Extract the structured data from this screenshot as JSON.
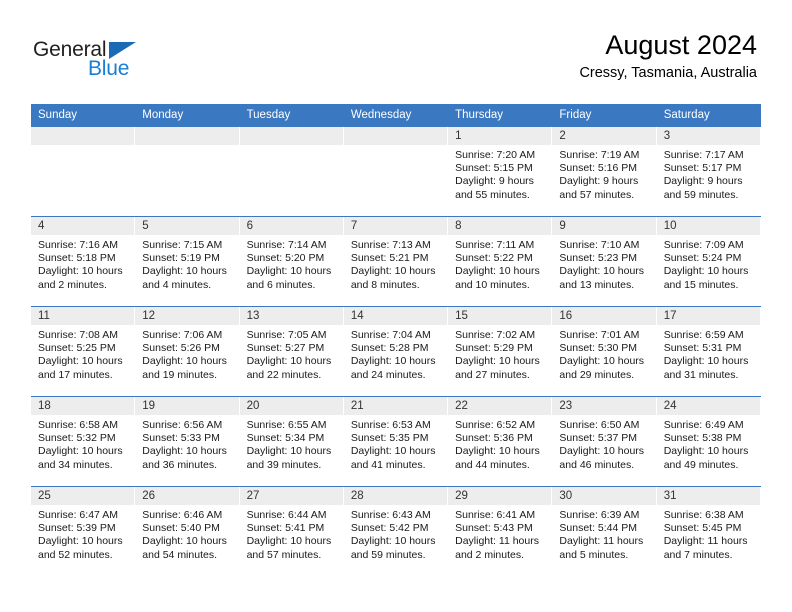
{
  "brand": {
    "name_part1": "General",
    "name_part2": "Blue",
    "triangle_color": "#1a6bb5",
    "blue_color": "#1a7fd4"
  },
  "header": {
    "title": "August 2024",
    "subtitle": "Cressy, Tasmania, Australia"
  },
  "theme": {
    "header_bg": "#3a78c2",
    "header_text": "#ffffff",
    "daynum_bg": "#ededed",
    "cell_bg": "#ffffff",
    "grid_line": "#3a78c2"
  },
  "weekday_headers": [
    "Sunday",
    "Monday",
    "Tuesday",
    "Wednesday",
    "Thursday",
    "Friday",
    "Saturday"
  ],
  "weeks": [
    [
      {
        "day": "",
        "sunrise": "",
        "sunset": "",
        "daylight_line1": "",
        "daylight_line2": ""
      },
      {
        "day": "",
        "sunrise": "",
        "sunset": "",
        "daylight_line1": "",
        "daylight_line2": ""
      },
      {
        "day": "",
        "sunrise": "",
        "sunset": "",
        "daylight_line1": "",
        "daylight_line2": ""
      },
      {
        "day": "",
        "sunrise": "",
        "sunset": "",
        "daylight_line1": "",
        "daylight_line2": ""
      },
      {
        "day": "1",
        "sunrise": "Sunrise: 7:20 AM",
        "sunset": "Sunset: 5:15 PM",
        "daylight_line1": "Daylight: 9 hours",
        "daylight_line2": "and 55 minutes."
      },
      {
        "day": "2",
        "sunrise": "Sunrise: 7:19 AM",
        "sunset": "Sunset: 5:16 PM",
        "daylight_line1": "Daylight: 9 hours",
        "daylight_line2": "and 57 minutes."
      },
      {
        "day": "3",
        "sunrise": "Sunrise: 7:17 AM",
        "sunset": "Sunset: 5:17 PM",
        "daylight_line1": "Daylight: 9 hours",
        "daylight_line2": "and 59 minutes."
      }
    ],
    [
      {
        "day": "4",
        "sunrise": "Sunrise: 7:16 AM",
        "sunset": "Sunset: 5:18 PM",
        "daylight_line1": "Daylight: 10 hours",
        "daylight_line2": "and 2 minutes."
      },
      {
        "day": "5",
        "sunrise": "Sunrise: 7:15 AM",
        "sunset": "Sunset: 5:19 PM",
        "daylight_line1": "Daylight: 10 hours",
        "daylight_line2": "and 4 minutes."
      },
      {
        "day": "6",
        "sunrise": "Sunrise: 7:14 AM",
        "sunset": "Sunset: 5:20 PM",
        "daylight_line1": "Daylight: 10 hours",
        "daylight_line2": "and 6 minutes."
      },
      {
        "day": "7",
        "sunrise": "Sunrise: 7:13 AM",
        "sunset": "Sunset: 5:21 PM",
        "daylight_line1": "Daylight: 10 hours",
        "daylight_line2": "and 8 minutes."
      },
      {
        "day": "8",
        "sunrise": "Sunrise: 7:11 AM",
        "sunset": "Sunset: 5:22 PM",
        "daylight_line1": "Daylight: 10 hours",
        "daylight_line2": "and 10 minutes."
      },
      {
        "day": "9",
        "sunrise": "Sunrise: 7:10 AM",
        "sunset": "Sunset: 5:23 PM",
        "daylight_line1": "Daylight: 10 hours",
        "daylight_line2": "and 13 minutes."
      },
      {
        "day": "10",
        "sunrise": "Sunrise: 7:09 AM",
        "sunset": "Sunset: 5:24 PM",
        "daylight_line1": "Daylight: 10 hours",
        "daylight_line2": "and 15 minutes."
      }
    ],
    [
      {
        "day": "11",
        "sunrise": "Sunrise: 7:08 AM",
        "sunset": "Sunset: 5:25 PM",
        "daylight_line1": "Daylight: 10 hours",
        "daylight_line2": "and 17 minutes."
      },
      {
        "day": "12",
        "sunrise": "Sunrise: 7:06 AM",
        "sunset": "Sunset: 5:26 PM",
        "daylight_line1": "Daylight: 10 hours",
        "daylight_line2": "and 19 minutes."
      },
      {
        "day": "13",
        "sunrise": "Sunrise: 7:05 AM",
        "sunset": "Sunset: 5:27 PM",
        "daylight_line1": "Daylight: 10 hours",
        "daylight_line2": "and 22 minutes."
      },
      {
        "day": "14",
        "sunrise": "Sunrise: 7:04 AM",
        "sunset": "Sunset: 5:28 PM",
        "daylight_line1": "Daylight: 10 hours",
        "daylight_line2": "and 24 minutes."
      },
      {
        "day": "15",
        "sunrise": "Sunrise: 7:02 AM",
        "sunset": "Sunset: 5:29 PM",
        "daylight_line1": "Daylight: 10 hours",
        "daylight_line2": "and 27 minutes."
      },
      {
        "day": "16",
        "sunrise": "Sunrise: 7:01 AM",
        "sunset": "Sunset: 5:30 PM",
        "daylight_line1": "Daylight: 10 hours",
        "daylight_line2": "and 29 minutes."
      },
      {
        "day": "17",
        "sunrise": "Sunrise: 6:59 AM",
        "sunset": "Sunset: 5:31 PM",
        "daylight_line1": "Daylight: 10 hours",
        "daylight_line2": "and 31 minutes."
      }
    ],
    [
      {
        "day": "18",
        "sunrise": "Sunrise: 6:58 AM",
        "sunset": "Sunset: 5:32 PM",
        "daylight_line1": "Daylight: 10 hours",
        "daylight_line2": "and 34 minutes."
      },
      {
        "day": "19",
        "sunrise": "Sunrise: 6:56 AM",
        "sunset": "Sunset: 5:33 PM",
        "daylight_line1": "Daylight: 10 hours",
        "daylight_line2": "and 36 minutes."
      },
      {
        "day": "20",
        "sunrise": "Sunrise: 6:55 AM",
        "sunset": "Sunset: 5:34 PM",
        "daylight_line1": "Daylight: 10 hours",
        "daylight_line2": "and 39 minutes."
      },
      {
        "day": "21",
        "sunrise": "Sunrise: 6:53 AM",
        "sunset": "Sunset: 5:35 PM",
        "daylight_line1": "Daylight: 10 hours",
        "daylight_line2": "and 41 minutes."
      },
      {
        "day": "22",
        "sunrise": "Sunrise: 6:52 AM",
        "sunset": "Sunset: 5:36 PM",
        "daylight_line1": "Daylight: 10 hours",
        "daylight_line2": "and 44 minutes."
      },
      {
        "day": "23",
        "sunrise": "Sunrise: 6:50 AM",
        "sunset": "Sunset: 5:37 PM",
        "daylight_line1": "Daylight: 10 hours",
        "daylight_line2": "and 46 minutes."
      },
      {
        "day": "24",
        "sunrise": "Sunrise: 6:49 AM",
        "sunset": "Sunset: 5:38 PM",
        "daylight_line1": "Daylight: 10 hours",
        "daylight_line2": "and 49 minutes."
      }
    ],
    [
      {
        "day": "25",
        "sunrise": "Sunrise: 6:47 AM",
        "sunset": "Sunset: 5:39 PM",
        "daylight_line1": "Daylight: 10 hours",
        "daylight_line2": "and 52 minutes."
      },
      {
        "day": "26",
        "sunrise": "Sunrise: 6:46 AM",
        "sunset": "Sunset: 5:40 PM",
        "daylight_line1": "Daylight: 10 hours",
        "daylight_line2": "and 54 minutes."
      },
      {
        "day": "27",
        "sunrise": "Sunrise: 6:44 AM",
        "sunset": "Sunset: 5:41 PM",
        "daylight_line1": "Daylight: 10 hours",
        "daylight_line2": "and 57 minutes."
      },
      {
        "day": "28",
        "sunrise": "Sunrise: 6:43 AM",
        "sunset": "Sunset: 5:42 PM",
        "daylight_line1": "Daylight: 10 hours",
        "daylight_line2": "and 59 minutes."
      },
      {
        "day": "29",
        "sunrise": "Sunrise: 6:41 AM",
        "sunset": "Sunset: 5:43 PM",
        "daylight_line1": "Daylight: 11 hours",
        "daylight_line2": "and 2 minutes."
      },
      {
        "day": "30",
        "sunrise": "Sunrise: 6:39 AM",
        "sunset": "Sunset: 5:44 PM",
        "daylight_line1": "Daylight: 11 hours",
        "daylight_line2": "and 5 minutes."
      },
      {
        "day": "31",
        "sunrise": "Sunrise: 6:38 AM",
        "sunset": "Sunset: 5:45 PM",
        "daylight_line1": "Daylight: 11 hours",
        "daylight_line2": "and 7 minutes."
      }
    ]
  ]
}
